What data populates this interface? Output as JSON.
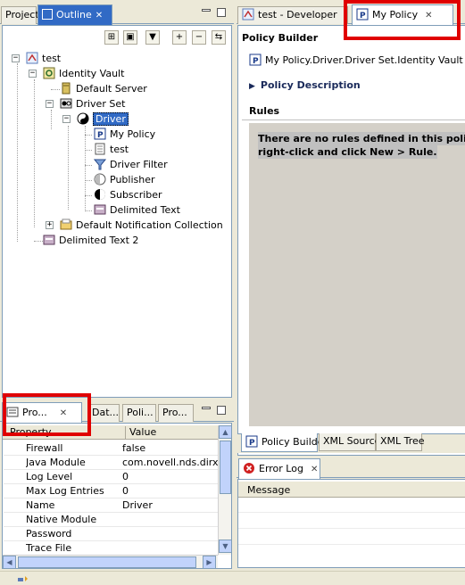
{
  "left_tabs": {
    "project": "Project",
    "outline": "Outline",
    "close": "✕"
  },
  "outline_toolbar_icons": [
    "tree-view-icon",
    "cube-icon",
    "filter-icon",
    "expand-all-icon",
    "collapse-all-icon",
    "sync-icon"
  ],
  "tree": [
    {
      "label": "test",
      "icon": "project-icon"
    },
    {
      "label": "Identity Vault",
      "icon": "identity-vault-icon"
    },
    {
      "label": "Default Server",
      "icon": "server-icon"
    },
    {
      "label": "Driver Set",
      "icon": "driver-set-icon"
    },
    {
      "label": "Driver",
      "icon": "driver-yinyang-icon"
    },
    {
      "label": "My Policy",
      "icon": "policy-icon"
    },
    {
      "label": "test",
      "icon": "document-icon"
    },
    {
      "label": "Driver Filter",
      "icon": "filter-icon"
    },
    {
      "label": "Publisher",
      "icon": "publisher-icon"
    },
    {
      "label": "Subscriber",
      "icon": "subscriber-icon"
    },
    {
      "label": "Delimited Text",
      "icon": "app-icon"
    },
    {
      "label": "Default Notification Collection",
      "icon": "notification-icon"
    },
    {
      "label": "Delimited Text 2",
      "icon": "app-icon"
    }
  ],
  "bottom_left_tabs": {
    "properties": "Pro...",
    "data": "Dat...",
    "policies": "Poli...",
    "problems": "Pro...",
    "close": "✕"
  },
  "properties": {
    "header_property": "Property",
    "header_value": "Value",
    "rows": [
      {
        "key": "Firewall",
        "value": "false"
      },
      {
        "key": "Java Module",
        "value": "com.novell.nds.dirxml."
      },
      {
        "key": "Log Level",
        "value": "0"
      },
      {
        "key": "Max Log Entries",
        "value": "0"
      },
      {
        "key": "Name",
        "value": "Driver"
      },
      {
        "key": "Native Module",
        "value": ""
      },
      {
        "key": "Password",
        "value": ""
      },
      {
        "key": "Trace File",
        "value": ""
      }
    ]
  },
  "editor_tabs": {
    "developer": "test - Developer",
    "policy": "My Policy",
    "close": "✕"
  },
  "policy_builder": {
    "title": "Policy Builder",
    "path": "My Policy.Driver.Driver Set.Identity Vault",
    "description_label": "Policy Description",
    "rules_label": "Rules",
    "no_rules_line1": "There are no rules defined in this policy. S",
    "no_rules_line2": "right-click and click New > Rule."
  },
  "editor_bottom_tabs": {
    "policy_builder": "Policy Builder",
    "xml_source": "XML Source",
    "xml_tree": "XML Tree"
  },
  "error_log": {
    "tab": "Error Log",
    "close": "✕",
    "column_message": "Message"
  },
  "colors": {
    "highlight": "#e00000",
    "selection": "#316ac5",
    "rules_panel": "#d4d0c8"
  }
}
